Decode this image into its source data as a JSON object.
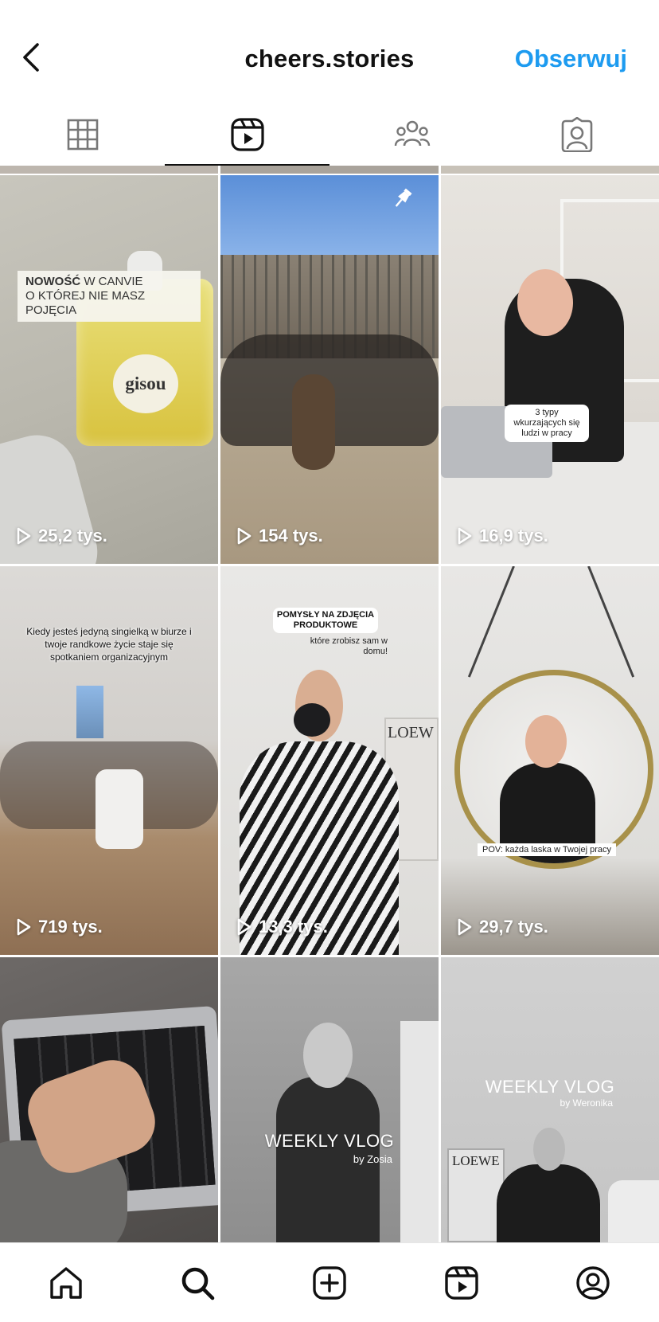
{
  "header": {
    "title": "cheers.stories",
    "follow_label": "Obserwuj"
  },
  "tabs": [
    {
      "icon": "grid-icon",
      "active": false
    },
    {
      "icon": "reels-icon",
      "active": true
    },
    {
      "icon": "people-icon",
      "active": false
    },
    {
      "icon": "tagged-icon",
      "active": false
    }
  ],
  "reels": [
    {
      "views": "25,2 tys.",
      "caption_line1_bold": "NOWOŚĆ",
      "caption_line1_rest": "W CANVIE",
      "caption_line2": "O KTÓREJ NIE MASZ POJĘCIA",
      "product_label": "gisou"
    },
    {
      "views": "154 tys.",
      "pinned": true
    },
    {
      "views": "16,9 tys.",
      "caption": "3 typy wkurzających się ludzi w pracy"
    },
    {
      "views": "719 tys.",
      "caption": "Kiedy jesteś jedyną singielką w biurze i twoje randkowe życie staje się spotkaniem organizacyjnym"
    },
    {
      "views": "13,3 tys.",
      "caption_title": "POMYSŁY NA ZDJĘCIA PRODUKTOWE",
      "caption_sub": "które zrobisz sam w domu!",
      "poster_label": "LOEW"
    },
    {
      "views": "29,7 tys.",
      "caption": "POV: każda laska w Twojej pracy"
    },
    {
      "views": ""
    },
    {
      "views": "",
      "overlay_title": "WEEKLY VLOG",
      "overlay_sub": "by Zosia"
    },
    {
      "views": "",
      "overlay_title": "WEEKLY VLOG",
      "overlay_sub": "by Weronika",
      "poster_label": "LOEWE"
    }
  ],
  "bottom_nav": [
    {
      "icon": "home-icon"
    },
    {
      "icon": "search-icon"
    },
    {
      "icon": "create-icon"
    },
    {
      "icon": "reels-icon"
    },
    {
      "icon": "profile-icon"
    }
  ],
  "colors": {
    "accent": "#1d9bf0",
    "text": "#111111"
  }
}
